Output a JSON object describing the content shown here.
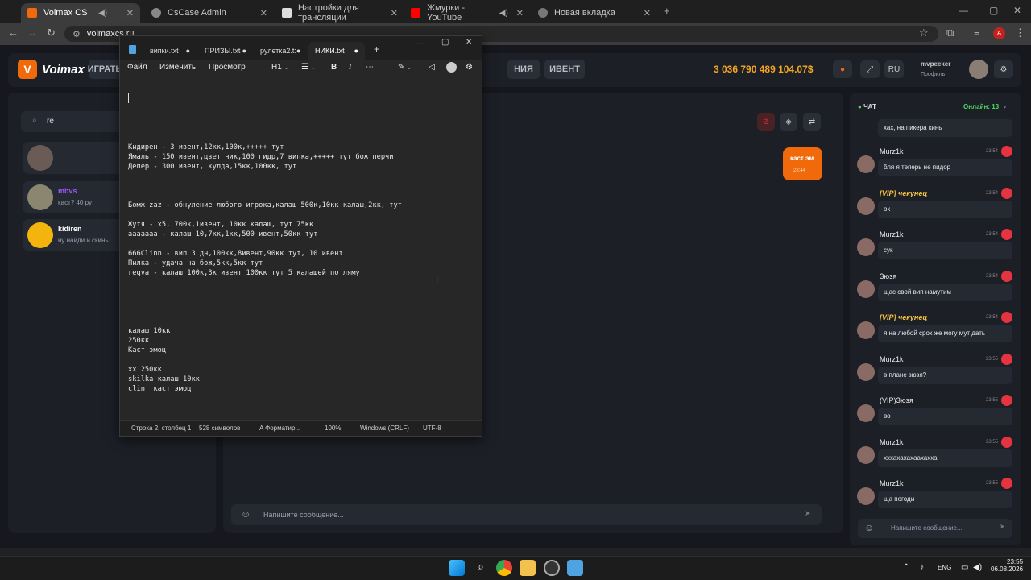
{
  "browser": {
    "tabs": [
      {
        "title": "Voimax CS",
        "active": true
      },
      {
        "title": "CsCase Admin"
      },
      {
        "title": "Настройки для трансляции"
      },
      {
        "title": "Жмурки - YouTube"
      },
      {
        "title": "Новая вкладка"
      }
    ],
    "new_tab": "+",
    "url": "voimaxcs.ru",
    "profile_letter": "A"
  },
  "site": {
    "logo_letter": "V",
    "logo_text": "Voimax",
    "nav": [
      "ИГРАТЬ",
      "НИЯ",
      "ИВЕНТ"
    ],
    "balance": "3 036 790 489 104.07$",
    "lang": "RU",
    "username": "mvpeeker",
    "profile_label": "Профиль",
    "search_value": "re",
    "dialogs": [
      {
        "name": "",
        "message": ""
      },
      {
        "name": "mbvs",
        "message": "каст? 40 ру"
      },
      {
        "name": "kidiren",
        "message": "ну найди и скинь."
      }
    ],
    "bubble": {
      "text": "каст эм",
      "time": "23:44"
    },
    "message_placeholder": "Напишите сообщение...",
    "chat": {
      "title": "ЧАТ",
      "online": "Онлайн: 13",
      "first_message": "хах, на пикера кинь",
      "messages": [
        {
          "name": "Murz1k",
          "time": "23:54",
          "text": "бля я теперь не пидор"
        },
        {
          "name": "[VIP] чекунец",
          "vip": true,
          "time": "23:54",
          "text": "ок"
        },
        {
          "name": "Murz1k",
          "time": "23:54",
          "text": "сук"
        },
        {
          "name": "Зюзя",
          "time": "23:54",
          "text": "щас свой вип намутим"
        },
        {
          "name": "[VIP] чекунец",
          "vip": true,
          "time": "23:54",
          "text": "я на любой срок же могу мут дать"
        },
        {
          "name": "Murz1k",
          "time": "23:55",
          "text": "в плане зюзя?"
        },
        {
          "name": "(VIP)Зюзя",
          "time": "23:55",
          "text": "во"
        },
        {
          "name": "Murz1k",
          "time": "23:55",
          "text": "хххахахахаахахха"
        },
        {
          "name": "Murz1k",
          "time": "23:55",
          "text": "ща погоди"
        }
      ],
      "input_placeholder": "Напишите сообщение..."
    }
  },
  "notepad": {
    "tabs": [
      "випки.txt",
      "ПРИЗЫ.txt",
      "рулетка2.t:",
      "НИКИ.txt"
    ],
    "active_tab": "НИКИ.txt",
    "menu": [
      "Файл",
      "Изменить",
      "Просмотр"
    ],
    "heading": "H1",
    "text": "Кидирен - 3 ивент,12кк,100к,+++++ тут\nЯмаль - 150 ивент,цвет ник,100 гидр,7 випка,+++++ тут бож перчи\nДепер - 300 ивент, кулда,15кк,100кк, тут\n\n\n\nБомж zaz - обнуление любого игрока,калаш 500к,10кк калаш,2кк, тут\n\nЖутя - x5, 700к,1ивент, 10кк калаш, тут 75кк\nааааааа - калаш 10,7кк,1кк,500 ивент,50кк тут\n\n666Clinn - вип 3 дн,100кк,8ивент,90кк тут, 10 ивент\nПилка - удача на бож,5кк,5кк тут\nreqva - калаш 100к,3к ивент 100кк тут 5 калашей по ляму\n\n\n\n\n\nкалаш 10кк\n250кк\nКаст эмоц\n\nхх 250кк\nskilka калаш 10кк\nclin  каст эмоц",
    "status": {
      "position": "Строка 2, столбец 1",
      "chars": "528 символов",
      "format": "Форматир...",
      "zoom": "100%",
      "eol": "Windows (CRLF)",
      "encoding": "UTF-8"
    }
  },
  "taskbar": {
    "lang": "ENG",
    "time": "23:55",
    "date": "06.08.2026"
  }
}
